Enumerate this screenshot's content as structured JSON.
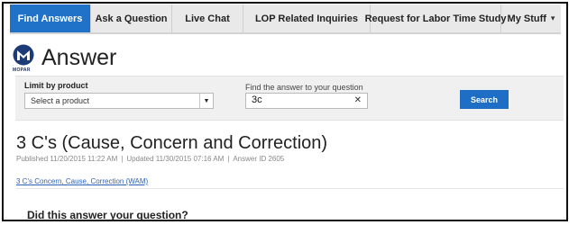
{
  "nav": {
    "tabs": [
      {
        "label": "Find Answers"
      },
      {
        "label": "Ask a Question"
      },
      {
        "label": "Live Chat"
      },
      {
        "label": "LOP Related Inquiries"
      },
      {
        "label": "Request for Labor Time Study"
      },
      {
        "label": "My Stuff"
      }
    ],
    "active_tab": "Find Answers",
    "active_color": "#1f72c7"
  },
  "brand": {
    "logo_text": "MOPAR",
    "title": "Answer"
  },
  "filter": {
    "limit_label": "Limit by product",
    "select_value": "Select a product",
    "find_label": "Find the answer to your question",
    "search_value": "3c",
    "search_button": "Search"
  },
  "article": {
    "title": "3 C's (Cause, Concern and Correction)",
    "published": "Published 11/20/2015 11:22 AM",
    "updated": "Updated 11/30/2015 07:16 AM",
    "answer_id": "Answer ID 2605",
    "link_text": "3 C's Concern, Cause, Correction (WAM)",
    "question": "Did this answer your question?"
  },
  "icons": {
    "clear": "close-icon",
    "dropdown": "chevron-down-icon",
    "logo": "mopar-logo-icon"
  }
}
